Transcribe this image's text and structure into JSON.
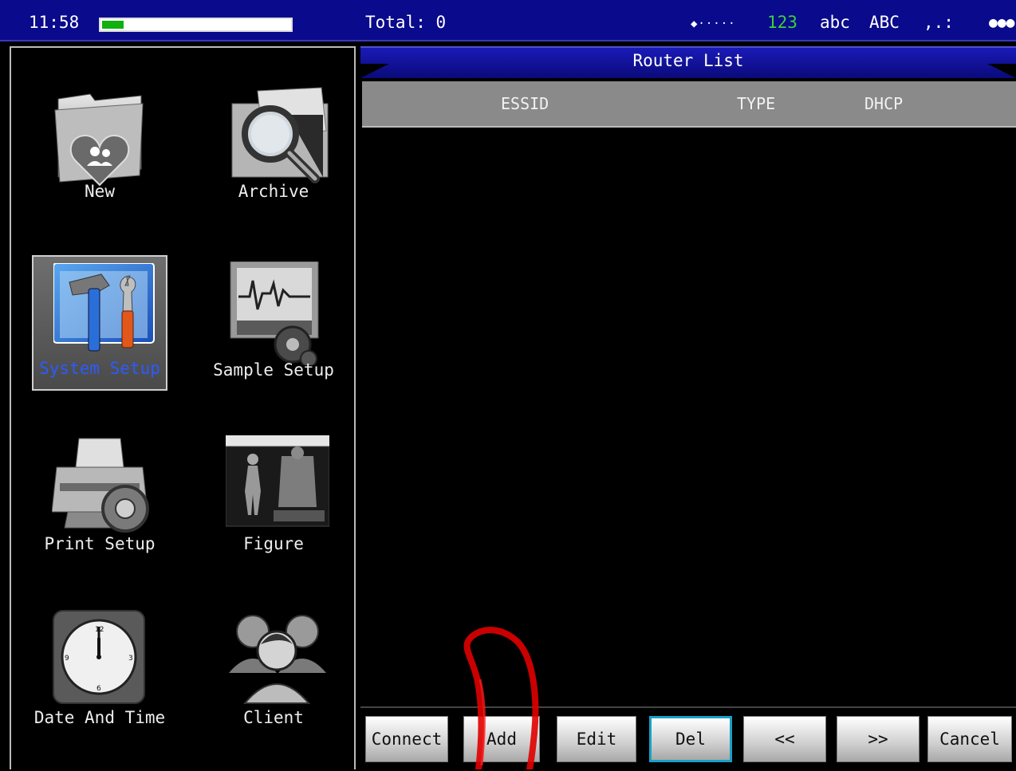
{
  "status_bar": {
    "time": "11:58",
    "battery_level_percent": 12,
    "total": "Total: 0",
    "ime_dots": "◆·····",
    "ime_numeric": "123",
    "ime_lowercase": "abc",
    "ime_uppercase": "ABC",
    "ime_punct": ",.:",
    "ime_more": "●●●",
    "colors": {
      "background": "#0a0a8c",
      "numeric_active": "#3ad23a",
      "battery_fill": "#10b010"
    }
  },
  "menu": {
    "items": [
      {
        "label": "New",
        "icon": "new-record-folder-icon"
      },
      {
        "label": "Archive",
        "icon": "archive-search-icon"
      },
      {
        "label": "System Setup",
        "icon": "system-setup-tools-icon",
        "selected": true
      },
      {
        "label": "Sample Setup",
        "icon": "sample-setup-monitor-icon"
      },
      {
        "label": "Print Setup",
        "icon": "printer-gear-icon"
      },
      {
        "label": "Figure",
        "icon": "figure-body-icon"
      },
      {
        "label": "Date And Time",
        "icon": "clock-icon"
      },
      {
        "label": "Client",
        "icon": "client-users-icon"
      }
    ],
    "selected_color": "#2b5bff"
  },
  "router_list": {
    "title": "Router List",
    "columns": [
      "ESSID",
      "TYPE",
      "DHCP"
    ],
    "rows": []
  },
  "buttons": {
    "connect": "Connect",
    "add": "Add",
    "edit": "Edit",
    "del": "Del",
    "prev": "<<",
    "next": ">>",
    "cancel": "Cancel",
    "focused": "del",
    "focus_color": "#1aa0c8"
  }
}
